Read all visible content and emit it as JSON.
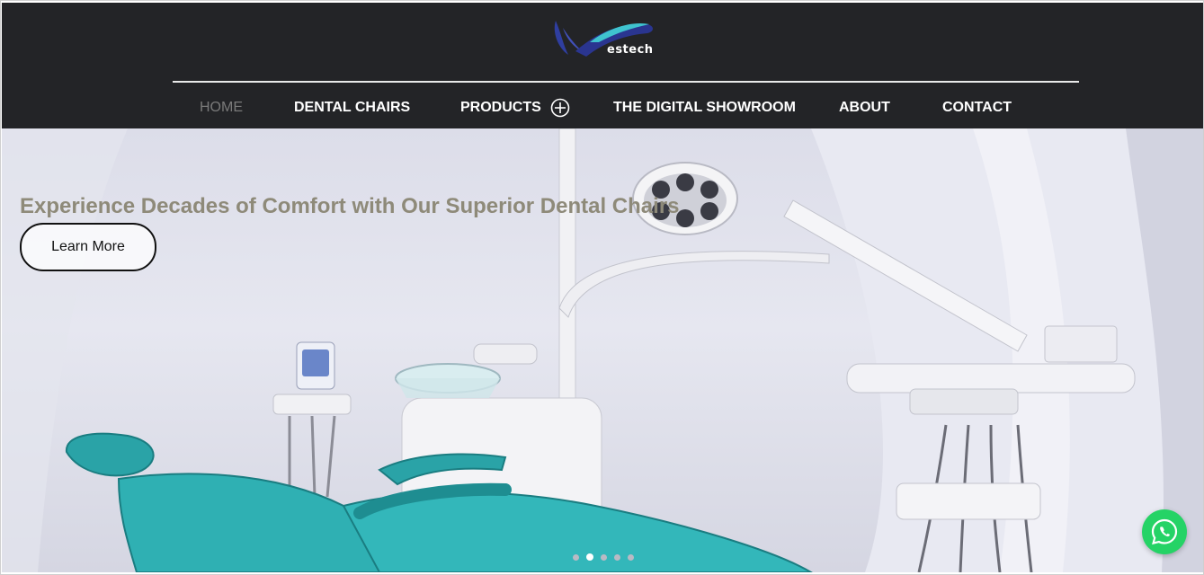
{
  "brand": {
    "logo_text": "estech",
    "colors": {
      "header_bg": "#232427",
      "accent_blue": "#2f3ea0",
      "accent_teal": "#37b8c7"
    }
  },
  "nav": {
    "items": [
      {
        "label": "HOME",
        "active": true
      },
      {
        "label": "DENTAL CHAIRS",
        "active": false
      },
      {
        "label": "PRODUCTS",
        "active": false,
        "has_submenu": true,
        "icon": "plus-circle-icon"
      },
      {
        "label": "THE DIGITAL SHOWROOM",
        "active": false
      },
      {
        "label": "ABOUT",
        "active": false
      },
      {
        "label": "CONTACT",
        "active": false
      }
    ]
  },
  "hero": {
    "title": "Experience Decades of Comfort with Our Superior Dental Chairs",
    "cta_label": "Learn More",
    "slider": {
      "count": 5,
      "active_index": 1
    }
  },
  "widgets": {
    "whatsapp": {
      "icon": "whatsapp-icon",
      "color": "#25d366"
    }
  }
}
